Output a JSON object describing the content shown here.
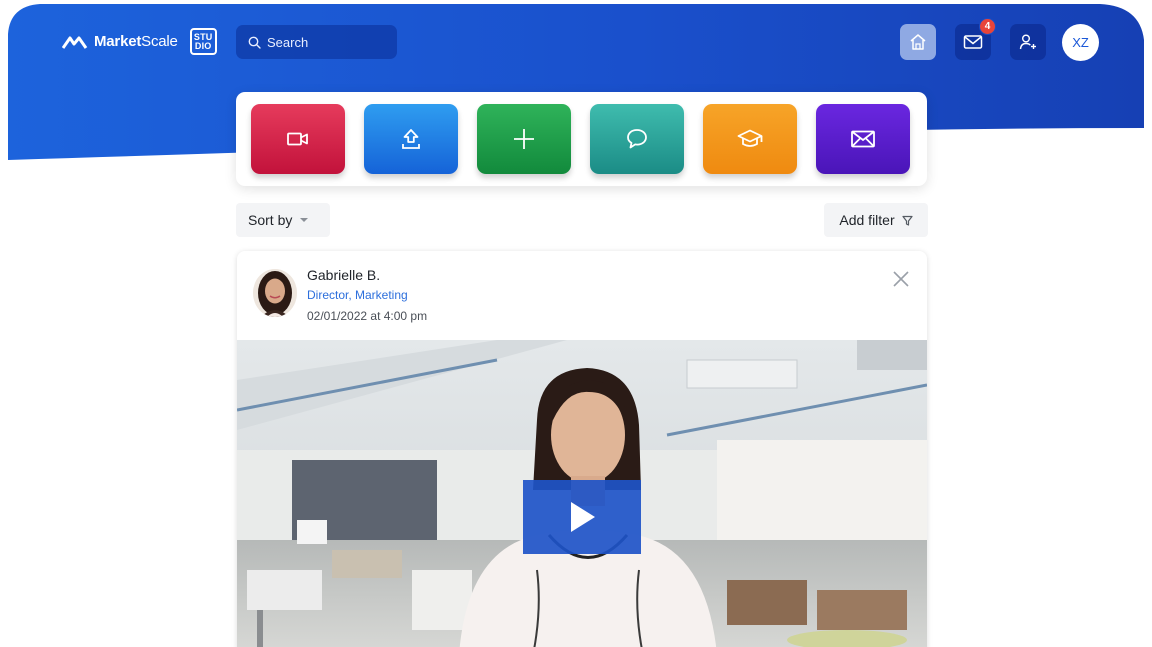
{
  "brand": {
    "name_bold": "Market",
    "name_regular": "Scale",
    "studio_line1": "STU",
    "studio_line2": "DIO"
  },
  "search": {
    "placeholder": "Search"
  },
  "nav": {
    "home_icon": "home-icon",
    "mail_icon": "mail-icon",
    "mail_badge": "4",
    "user_icon": "add-user-icon",
    "avatar_initials": "XZ"
  },
  "actions": [
    {
      "name": "video",
      "icon": "video-camera-icon",
      "color": "#d7264b"
    },
    {
      "name": "upload",
      "icon": "upload-icon",
      "color": "#1f80e6"
    },
    {
      "name": "add",
      "icon": "plus-icon",
      "color": "#22a04c"
    },
    {
      "name": "chat",
      "icon": "chat-bubble-icon",
      "color": "#2aa69b"
    },
    {
      "name": "learn",
      "icon": "graduation-cap-icon",
      "color": "#f49a1b"
    },
    {
      "name": "message",
      "icon": "envelope-icon",
      "color": "#5a1fcf"
    }
  ],
  "toolbar": {
    "sort_label": "Sort by",
    "filter_label": "Add filter"
  },
  "post": {
    "author_name": "Gabrielle B.",
    "author_title": "Director, Marketing",
    "timestamp": "02/01/2022 at 4:00 pm"
  },
  "colors": {
    "header_blue": "#1b55d4",
    "accent_blue": "#2d6fdc",
    "badge_red": "#e8443a"
  }
}
